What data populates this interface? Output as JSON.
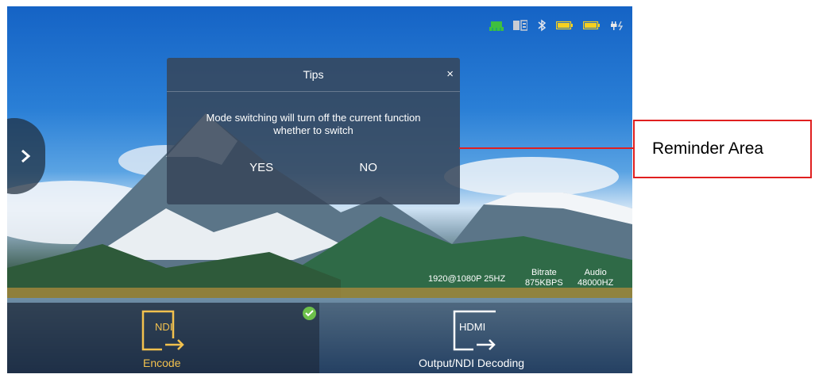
{
  "dialog": {
    "title": "Tips",
    "close": "×",
    "message_line1": "Mode switching will turn off the current function",
    "message_line2": "whether to switch",
    "yes": "YES",
    "no": "NO"
  },
  "info": {
    "resolution": "1920@1080P 25HZ",
    "bitrate_label": "Bitrate",
    "bitrate_value": "875KBPS",
    "audio_label": "Audio",
    "audio_value": "48000HZ"
  },
  "modes": [
    {
      "icon_text": "NDI",
      "label": "Encode",
      "selected": true,
      "color": "#f2c14e"
    },
    {
      "icon_text": "HDMI",
      "label": "Output/NDI Decoding",
      "selected": false,
      "color": "#ffffff"
    }
  ],
  "status_icons": [
    "network-icon",
    "sd-card-icon",
    "bluetooth-icon",
    "battery-icon",
    "battery-icon",
    "charging-icon"
  ],
  "colors": {
    "accent": "#f2c14e",
    "callout": "#e02020",
    "check": "#6cc04a"
  },
  "callout": {
    "label": "Reminder Area"
  }
}
